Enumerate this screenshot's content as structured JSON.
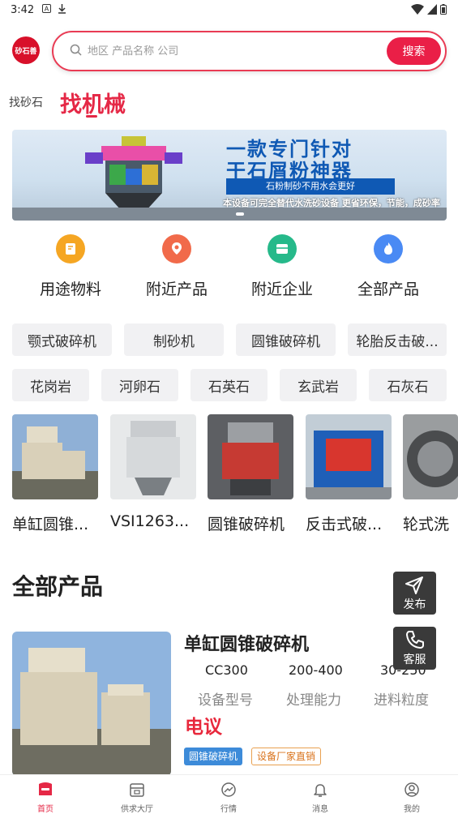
{
  "status_bar": {
    "time": "3:42"
  },
  "header": {
    "logo_text": "砂石善",
    "search_placeholder": "地区 产品名称 公司",
    "search_button": "搜索"
  },
  "tabs": {
    "inactive": "找砂石",
    "active": "找机械"
  },
  "banner": {
    "title_line1": "一款专门针对",
    "title_line2": "干石屑粉神器",
    "subtitle": "石粉制砂不用水会更好",
    "caption": "本设备可完全替代水洗砂设备 更省环保，节能，成砂率高！"
  },
  "categories": [
    {
      "label": "用途物料",
      "icon": "document-icon",
      "color": "#f5a623"
    },
    {
      "label": "附近产品",
      "icon": "location-pin-icon",
      "color": "#f16a4a"
    },
    {
      "label": "附近企业",
      "icon": "store-icon",
      "color": "#26b98a"
    },
    {
      "label": "全部产品",
      "icon": "fire-icon",
      "color": "#4a8af4"
    }
  ],
  "machine_chips": [
    "颚式破碎机",
    "制砂机",
    "圆锥破碎机",
    "轮胎反击破..."
  ],
  "material_chips": [
    "花岗岩",
    "河卵石",
    "石英石",
    "玄武岩",
    "石灰石"
  ],
  "products_row": [
    "单缸圆锥...",
    "VSI1263...",
    "圆锥破碎机",
    "反击式破...",
    "轮式洗"
  ],
  "section_title": "全部产品",
  "fab": {
    "publish": "发布",
    "service": "客服"
  },
  "listing": {
    "title": "单缸圆锥破碎机",
    "specs": [
      {
        "value": "CC300",
        "label": "设备型号"
      },
      {
        "value": "200-400",
        "label": "处理能力"
      },
      {
        "value": "30-250",
        "label": "进料粒度"
      }
    ],
    "price": "电议",
    "tags": [
      "圆锥破碎机",
      "设备厂家直销"
    ]
  },
  "bottom_nav": [
    "首页",
    "供求大厅",
    "行情",
    "消息",
    "我的"
  ],
  "colors": {
    "brand": "#e52846",
    "search_button": "#ea1f47"
  }
}
